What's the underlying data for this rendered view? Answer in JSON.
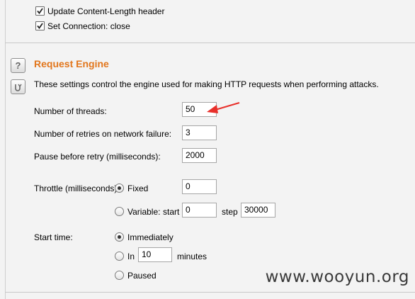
{
  "top_options": {
    "update_content_length": {
      "label": "Update Content-Length header",
      "checked": true
    },
    "set_connection_close": {
      "label": "Set Connection: close",
      "checked": true
    }
  },
  "request_engine": {
    "title": "Request Engine",
    "description": "These settings control the engine used for making HTTP requests when performing attacks.",
    "help_icon_glyph": "?",
    "number_of_threads": {
      "label": "Number of threads:",
      "value": "50"
    },
    "retries": {
      "label": "Number of retries on network failure:",
      "value": "3"
    },
    "pause_before_retry": {
      "label": "Pause before retry (milliseconds):",
      "value": "2000"
    },
    "throttle": {
      "label": "Throttle (milliseconds):",
      "fixed_label": "Fixed",
      "fixed_value": "0",
      "variable_label": "Variable:",
      "start_label": "start",
      "start_value": "0",
      "step_label": "step",
      "step_value": "30000",
      "selected": "fixed"
    },
    "start_time": {
      "label": "Start time:",
      "immediately_label": "Immediately",
      "in_label": "In",
      "in_value": "10",
      "minutes_label": "minutes",
      "paused_label": "Paused",
      "selected": "immediately"
    }
  },
  "annotation_arrow_color": "#e8302b",
  "watermark": "www.wooyun.org",
  "colors": {
    "title": "#e2761c",
    "background": "#f3f3f3"
  }
}
